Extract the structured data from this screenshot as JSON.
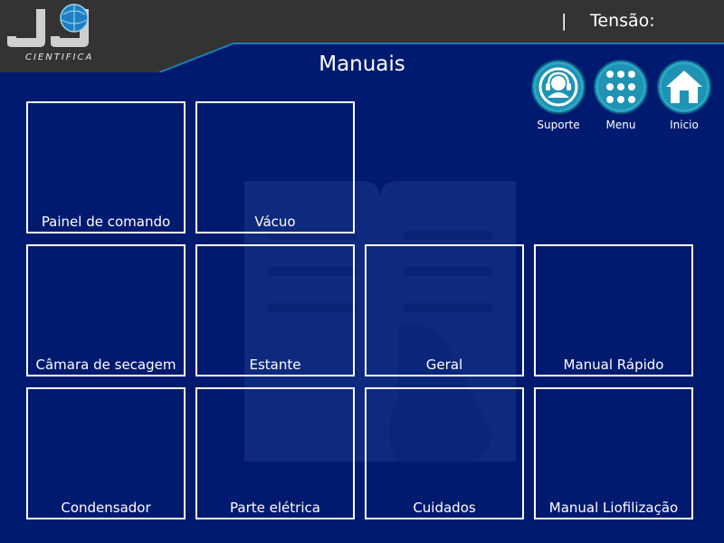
{
  "header": {
    "logo_text": "CIENTIFICA",
    "separator": "|",
    "tension_label": "Tensão:",
    "tension_value": ""
  },
  "page": {
    "title": "Manuais"
  },
  "nav": {
    "suporte": {
      "label": "Suporte",
      "icon": "support-headset-icon"
    },
    "menu": {
      "label": "Menu",
      "icon": "grid-menu-icon"
    },
    "inicio": {
      "label": "Inicio",
      "icon": "home-icon"
    }
  },
  "manuals": [
    {
      "label": "Painel de comando"
    },
    {
      "label": "Vácuo"
    },
    {
      "label": "Câmara de secagem"
    },
    {
      "label": "Estante"
    },
    {
      "label": "Geral"
    },
    {
      "label": "Manual Rápido"
    },
    {
      "label": "Condensador"
    },
    {
      "label": "Parte elétrica"
    },
    {
      "label": "Cuidados"
    },
    {
      "label": "Manual Liofilização"
    }
  ],
  "colors": {
    "background": "#001a70",
    "header": "#333333",
    "accent": "#1f93b4",
    "tile_border": "#ffffff"
  }
}
